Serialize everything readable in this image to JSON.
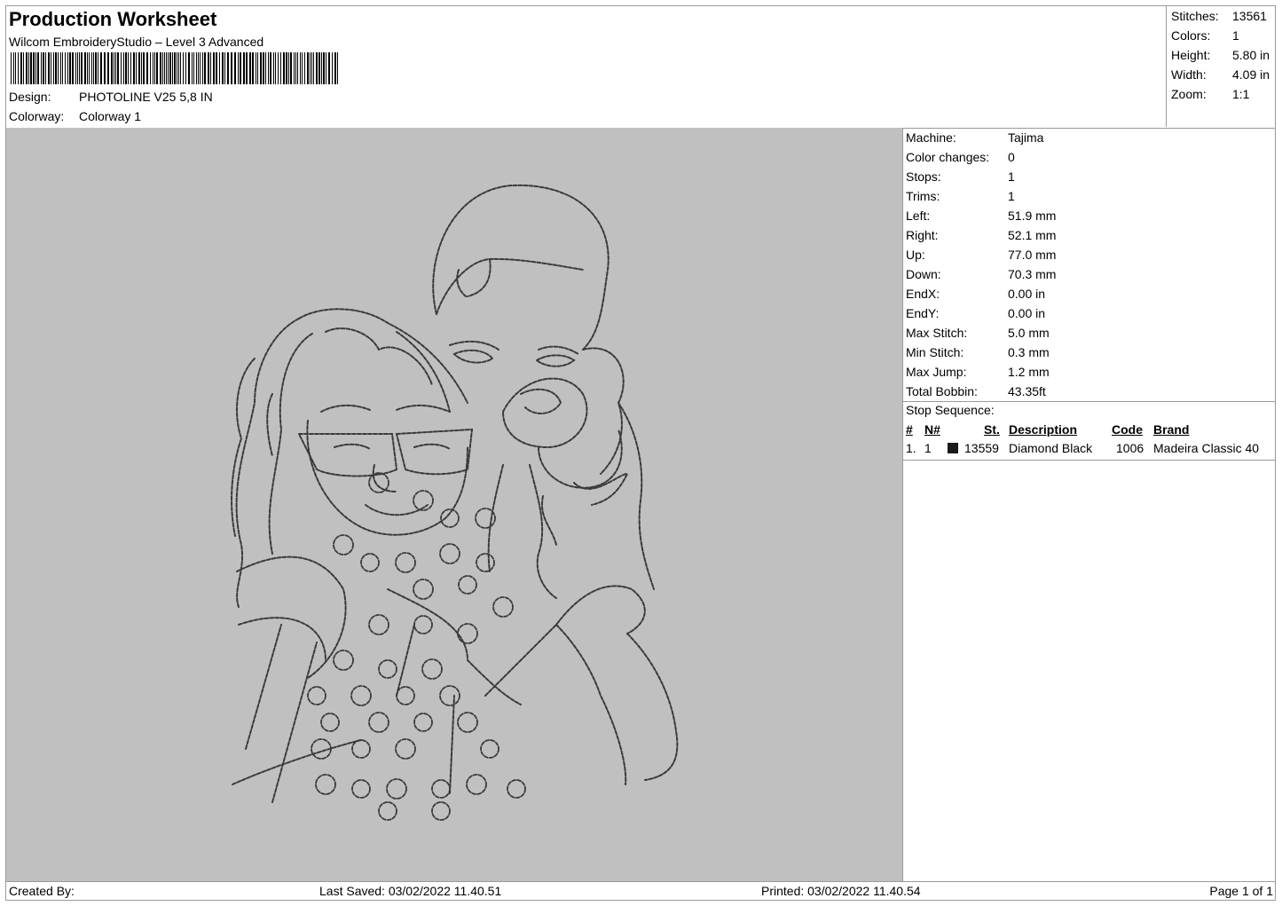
{
  "header": {
    "title": "Production Worksheet",
    "subtitle": "Wilcom EmbroideryStudio – Level 3 Advanced",
    "design_label": "Design:",
    "design_value": "PHOTOLINE V25 5,8 IN",
    "colorway_label": "Colorway:",
    "colorway_value": "Colorway 1"
  },
  "summary": [
    {
      "k": "Stitches:",
      "v": "13561"
    },
    {
      "k": "Colors:",
      "v": "1"
    },
    {
      "k": "Height:",
      "v": "5.80 in"
    },
    {
      "k": "Width:",
      "v": "4.09 in"
    },
    {
      "k": "Zoom:",
      "v": "1:1"
    }
  ],
  "machine_info": [
    {
      "k": "Machine:",
      "v": "Tajima"
    },
    {
      "k": "Color changes:",
      "v": "0"
    },
    {
      "k": "Stops:",
      "v": "1"
    },
    {
      "k": "Trims:",
      "v": "1"
    },
    {
      "k": "Left:",
      "v": "51.9 mm"
    },
    {
      "k": "Right:",
      "v": "52.1 mm"
    },
    {
      "k": "Up:",
      "v": "77.0 mm"
    },
    {
      "k": "Down:",
      "v": "70.3 mm"
    },
    {
      "k": "EndX:",
      "v": "0.00 in"
    },
    {
      "k": "EndY:",
      "v": "0.00 in"
    },
    {
      "k": "Max Stitch:",
      "v": "5.0 mm"
    },
    {
      "k": "Min Stitch:",
      "v": "0.3 mm"
    },
    {
      "k": "Max Jump:",
      "v": "1.2 mm"
    },
    {
      "k": "Total Bobbin:",
      "v": "43.35ft"
    }
  ],
  "stop_sequence": {
    "label": "Stop Sequence:",
    "headers": {
      "num": "#",
      "needle": "N#",
      "stitches": "St.",
      "description": "Description",
      "code": "Code",
      "brand": "Brand"
    },
    "rows": [
      {
        "num": "1.",
        "needle": "1",
        "color": "#1a1a1a",
        "stitches": "13559",
        "description": "Diamond Black",
        "code": "1006",
        "brand": "Madeira Classic 40"
      }
    ]
  },
  "footer": {
    "created_by": "Created By:",
    "last_saved": "Last Saved: 03/02/2022 11.40.51",
    "printed": "Printed: 03/02/2022 11.40.54",
    "page": "Page 1 of 1"
  },
  "colors": {
    "canvas": "#c0c0c0",
    "thread": "#3a3a3a"
  }
}
